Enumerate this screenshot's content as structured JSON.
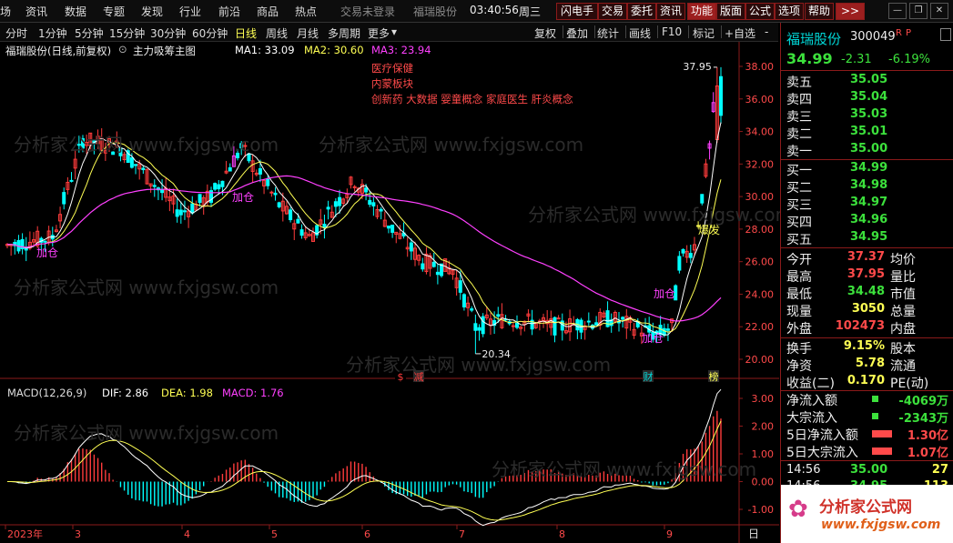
{
  "menu": {
    "items": [
      "场",
      "资讯",
      "数据",
      "专题",
      "发现",
      "行业",
      "前沿",
      "商品",
      "热点"
    ],
    "status": "交易未登录",
    "stock": "福瑞股份",
    "time": "03:40:56",
    "weekday": "周三",
    "buttons": [
      "闪电手",
      "交易",
      "委托",
      "资讯",
      "功能",
      "版面",
      "公式",
      "选项",
      "帮助"
    ],
    "more": ">>"
  },
  "periods": [
    "分时",
    "1分钟",
    "5分钟",
    "15分钟",
    "30分钟",
    "60分钟",
    "日线",
    "周线",
    "月线",
    "多周期",
    "更多"
  ],
  "active_period": "日线",
  "tools": [
    "复权",
    "叠加",
    "统计",
    "画线",
    "F10",
    "标记",
    "+自选",
    "-"
  ],
  "chart": {
    "title": "福瑞股份(日线,前复权)",
    "formula": "主力吸筹主图",
    "ma1": "MA1: 33.09",
    "ma2": "MA2: 30.60",
    "ma3": "MA3: 23.94",
    "concepts": [
      "医疗保健",
      "内蒙板块",
      "创新药 大数据 婴童概念 家庭医生 肝炎概念"
    ],
    "high_label": "37.95",
    "low_label": "20.34",
    "buy_labels": [
      "加仓",
      "加仓",
      "加仓",
      "加仓"
    ],
    "burst_label": "爆发",
    "event_markers": [
      "$",
      "减",
      "财",
      "榜"
    ],
    "price_axis": [
      "38.00",
      "36.00",
      "34.00",
      "32.00",
      "30.00",
      "28.00",
      "26.00",
      "24.00",
      "22.00",
      "20.00"
    ],
    "macd_title": "MACD(12,26,9)",
    "dif": "DIF: 2.86",
    "dea": "DEA: 1.98",
    "macd": "MACD: 1.76",
    "macd_axis": [
      "3.00",
      "2.00",
      "1.00",
      "0.00",
      "-1.00"
    ],
    "date_axis": [
      "2023年",
      "3",
      "4",
      "5",
      "6",
      "7",
      "8",
      "9"
    ],
    "date_unit": "日",
    "watermark": "分析家公式网 www.fxjgsw.com"
  },
  "quote": {
    "name": "福瑞股份",
    "code": "300049",
    "flags": [
      "R",
      "P"
    ],
    "price": "34.99",
    "change": "-2.31",
    "pct": "-6.19%",
    "asks": [
      {
        "label": "卖五",
        "price": "35.05",
        "vol": ""
      },
      {
        "label": "卖四",
        "price": "35.04",
        "vol": ""
      },
      {
        "label": "卖三",
        "price": "35.03",
        "vol": ""
      },
      {
        "label": "卖二",
        "price": "35.01",
        "vol": ""
      },
      {
        "label": "卖一",
        "price": "35.00",
        "vol": ""
      }
    ],
    "bids": [
      {
        "label": "买一",
        "price": "34.99",
        "vol": ""
      },
      {
        "label": "买二",
        "price": "34.98",
        "vol": ""
      },
      {
        "label": "买三",
        "price": "34.97",
        "vol": ""
      },
      {
        "label": "买四",
        "price": "34.96",
        "vol": ""
      },
      {
        "label": "买五",
        "price": "34.95",
        "vol": ""
      }
    ],
    "stats": [
      {
        "l1": "今开",
        "v1": "37.37",
        "c1": "red",
        "l2": "均价"
      },
      {
        "l1": "最高",
        "v1": "37.95",
        "c1": "red",
        "l2": "量比"
      },
      {
        "l1": "最低",
        "v1": "34.48",
        "c1": "green",
        "l2": "市值"
      },
      {
        "l1": "现量",
        "v1": "3050",
        "c1": "yellow",
        "l2": "总量"
      },
      {
        "l1": "外盘",
        "v1": "102473",
        "c1": "red",
        "l2": "内盘"
      },
      {
        "l1": "换手",
        "v1": "9.15%",
        "c1": "yellow",
        "l2": "股本"
      },
      {
        "l1": "净资",
        "v1": "5.78",
        "c1": "yellow",
        "l2": "流通"
      },
      {
        "l1": "收益(二)",
        "v1": "0.170",
        "c1": "yellow",
        "l2": "PE(动)"
      }
    ],
    "flows": [
      {
        "label": "净流入额",
        "value": "-4069万"
      },
      {
        "label": "大宗流入",
        "value": "-2343万"
      },
      {
        "label": "5日净流入额",
        "value": "1.30亿"
      },
      {
        "label": "5日大宗流入",
        "value": "1.07亿"
      }
    ],
    "ticks": [
      {
        "time": "14:56",
        "price": "35.00",
        "vol": "27"
      },
      {
        "time": "14:56",
        "price": "34.95",
        "vol": "113"
      }
    ],
    "logo_text": "分析家公式网",
    "logo_url": "www.fxjgsw.com"
  },
  "colors": {
    "up": "#ff3c3c",
    "down": "#00ffff",
    "ma1": "#ffffff",
    "ma2": "#ffff54",
    "ma3": "#ff40ff",
    "accent": "#8b1a1a"
  }
}
